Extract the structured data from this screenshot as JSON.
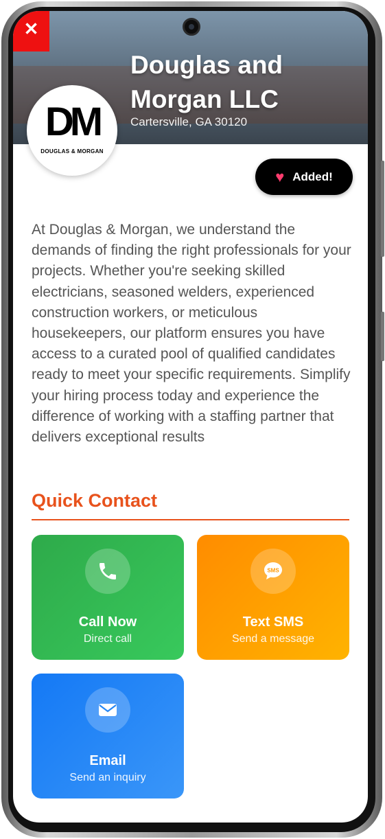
{
  "header": {
    "close_label": "✕",
    "company_name": "Douglas and Morgan LLC",
    "location": "Cartersville, GA 30120"
  },
  "logo": {
    "mark": "DM",
    "text": "DOUGLAS & MORGAN"
  },
  "favorite": {
    "label": "Added!",
    "icon": "heart-icon"
  },
  "description": "At Douglas & Morgan, we understand the demands of finding the right professionals for your projects. Whether you're seeking skilled electricians, seasoned welders, experienced construction workers, or meticulous housekeepers, our platform ensures you have access to a curated pool of qualified candidates ready to meet your specific requirements. Simplify your hiring process today and experience the difference of working with a staffing partner that delivers exceptional results",
  "quick_contact": {
    "title": "Quick Contact",
    "cards": [
      {
        "icon": "phone-icon",
        "title": "Call Now",
        "subtitle": "Direct call",
        "color": "#34b954"
      },
      {
        "icon": "sms-icon",
        "title": "Text SMS",
        "subtitle": "Send a message",
        "color": "#ffa000"
      },
      {
        "icon": "mail-icon",
        "title": "Email",
        "subtitle": "Send an inquiry",
        "color": "#2587f6"
      }
    ]
  },
  "colors": {
    "accent": "#e8521c",
    "close": "#ee1111"
  }
}
